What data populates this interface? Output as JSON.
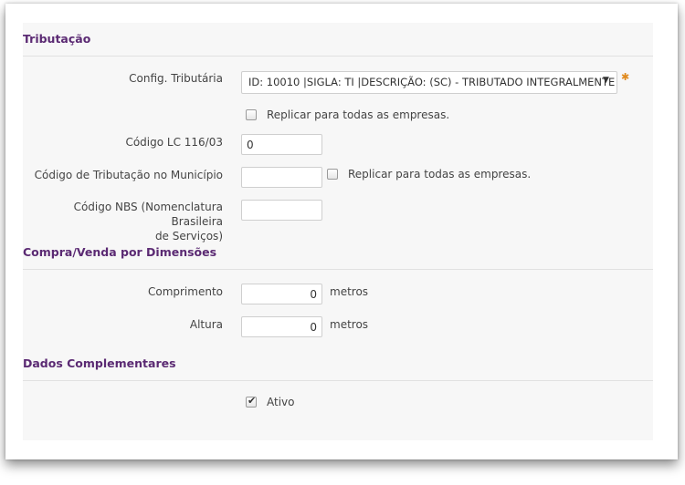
{
  "sections": {
    "tributacao": "Tributação",
    "compra_venda": "Compra/Venda por Dimensões",
    "dados_complementares": "Dados Complementares"
  },
  "tributacao": {
    "config_label": "Config. Tributária",
    "config_value": "ID: 10010 |SIGLA: TI |DESCRIÇÃO: (SC) - TRIBUTADO INTEGRALMENTE",
    "replicar_label": "Replicar para todas as empresas.",
    "codigo_lc_label": "Código LC 116/03",
    "codigo_lc_value": "0",
    "codigo_municipio_label": "Código de Tributação no Município",
    "codigo_municipio_value": "",
    "replicar_municipio_label": "Replicar para todas as empresas.",
    "codigo_nbs_label_line1": "Código NBS (Nomenclatura Brasileira",
    "codigo_nbs_label_line2": "de Serviços)",
    "codigo_nbs_value": ""
  },
  "dimensoes": {
    "comprimento_label": "Comprimento",
    "comprimento_value": "0",
    "comprimento_unit": "metros",
    "altura_label": "Altura",
    "altura_value": "0",
    "altura_unit": "metros"
  },
  "complementares": {
    "ativo_label": "Ativo",
    "ativo_checked": true
  },
  "icons": {
    "required": "asterisk-icon",
    "dropdown": "triangle-down-icon",
    "check": "check-icon"
  },
  "colors": {
    "section_title": "#5b2a73",
    "required": "#e08a1e"
  }
}
